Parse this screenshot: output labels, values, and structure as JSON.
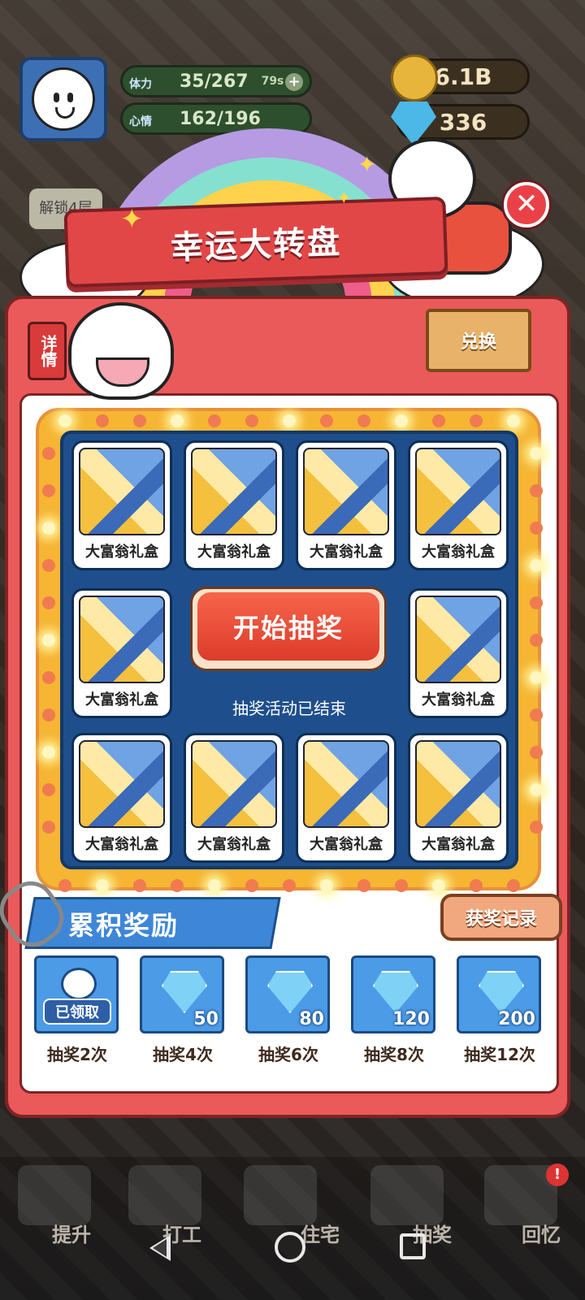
{
  "hud": {
    "stamina_label": "体力",
    "stamina_value": "35/267",
    "stamina_timer": "79s",
    "mood_label": "心情",
    "mood_value": "162/196",
    "coins": "6.1B",
    "gems": "336",
    "unlock_text": "解锁4层"
  },
  "title": "幸运大转盘",
  "detail_label": "详情",
  "exchange_label": "兑换",
  "prizes": [
    "大富翁礼盒",
    "大富翁礼盒",
    "大富翁礼盒",
    "大富翁礼盒",
    "大富翁礼盒",
    "大富翁礼盒",
    "大富翁礼盒",
    "大富翁礼盒",
    "大富翁礼盒",
    "大富翁礼盒"
  ],
  "start_button": "开始抽奖",
  "ended_text": "抽奖活动已结束",
  "cumulative_title": "累积奖励",
  "record_label": "获奖记录",
  "rewards": [
    {
      "caption": "抽奖2次",
      "status": "已领取"
    },
    {
      "caption": "抽奖4次",
      "amount": "50"
    },
    {
      "caption": "抽奖6次",
      "amount": "80"
    },
    {
      "caption": "抽奖8次",
      "amount": "120"
    },
    {
      "caption": "抽奖12次",
      "amount": "200"
    }
  ],
  "game_nav": [
    "提升",
    "打工",
    "住宅",
    "抽奖",
    "回忆"
  ],
  "alert_badge": "!",
  "colors": {
    "panel": "#ea5a5a",
    "board": "#1e4f8c",
    "marquee": "#f6b533",
    "start_button": "#e64a35",
    "reward_tile": "#4c9be7"
  }
}
